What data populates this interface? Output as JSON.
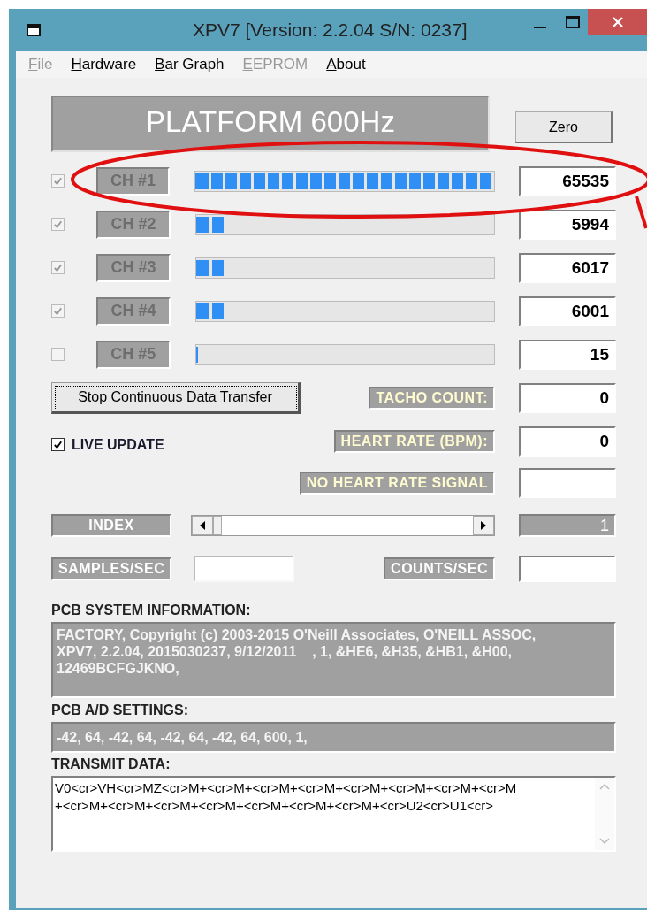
{
  "window": {
    "title": "XPV7 [Version: 2.2.04 S/N: 0237]"
  },
  "menu": [
    {
      "label": "File",
      "disabled": true
    },
    {
      "label": "Hardware",
      "disabled": false
    },
    {
      "label": "Bar Graph",
      "disabled": false
    },
    {
      "label": "EEPROM",
      "disabled": true
    },
    {
      "label": "About",
      "disabled": false
    }
  ],
  "platform": {
    "title": "PLATFORM 600Hz"
  },
  "zero_button": "Zero",
  "channels": [
    {
      "label": "CH #1",
      "checked": true,
      "disabled": true,
      "level": 1,
      "value": "65535"
    },
    {
      "label": "CH #2",
      "checked": true,
      "disabled": true,
      "level": 0.09,
      "value": "5994"
    },
    {
      "label": "CH #3",
      "checked": true,
      "disabled": true,
      "level": 0.09,
      "value": "6017"
    },
    {
      "label": "CH #4",
      "checked": true,
      "disabled": true,
      "level": 0.09,
      "value": "6001"
    },
    {
      "label": "CH #5",
      "checked": false,
      "disabled": true,
      "level": 0,
      "value": "15"
    }
  ],
  "stop_button": "Stop Continuous Data Transfer",
  "live_update": {
    "label": "LIVE UPDATE",
    "checked": true
  },
  "tacho_count": {
    "label": "TACHO COUNT:",
    "value": "0"
  },
  "heart_rate": {
    "label": "HEART RATE (BPM):",
    "value": "0"
  },
  "heart_signal": {
    "label": "NO HEART RATE SIGNAL"
  },
  "index": {
    "label": "INDEX",
    "value": "1"
  },
  "samples_per_sec": {
    "label": "SAMPLES/SEC"
  },
  "counts_per_sec": {
    "label": "COUNTS/SEC"
  },
  "system_info": {
    "label": "PCB SYSTEM INFORMATION:",
    "lines": [
      "FACTORY, Copyright (c) 2003-2015 O'Neill Associates, O'NEILL ASSOC,",
      "XPV7, 2.2.04, 2015030237, 9/12/2011    , 1, &HE6, &H35, &HB1, &H00,",
      "12469BCFGJKNO,"
    ]
  },
  "ad_settings": {
    "label": "PCB A/D SETTINGS:",
    "text": "-42, 64, -42, 64, -42, 64, -42, 64, 600, 1,"
  },
  "transmit_data": {
    "label": "TRANSMIT DATA:",
    "lines": [
      "V0<cr>VH<cr>MZ<cr>M+<cr>M+<cr>M+<cr>M+<cr>M+<cr>M+<cr>M+<cr>M",
      "+<cr>M+<cr>M+<cr>M+<cr>M+<cr>M+<cr>M+<cr>M+<cr>U2<cr>U1<cr>"
    ]
  }
}
